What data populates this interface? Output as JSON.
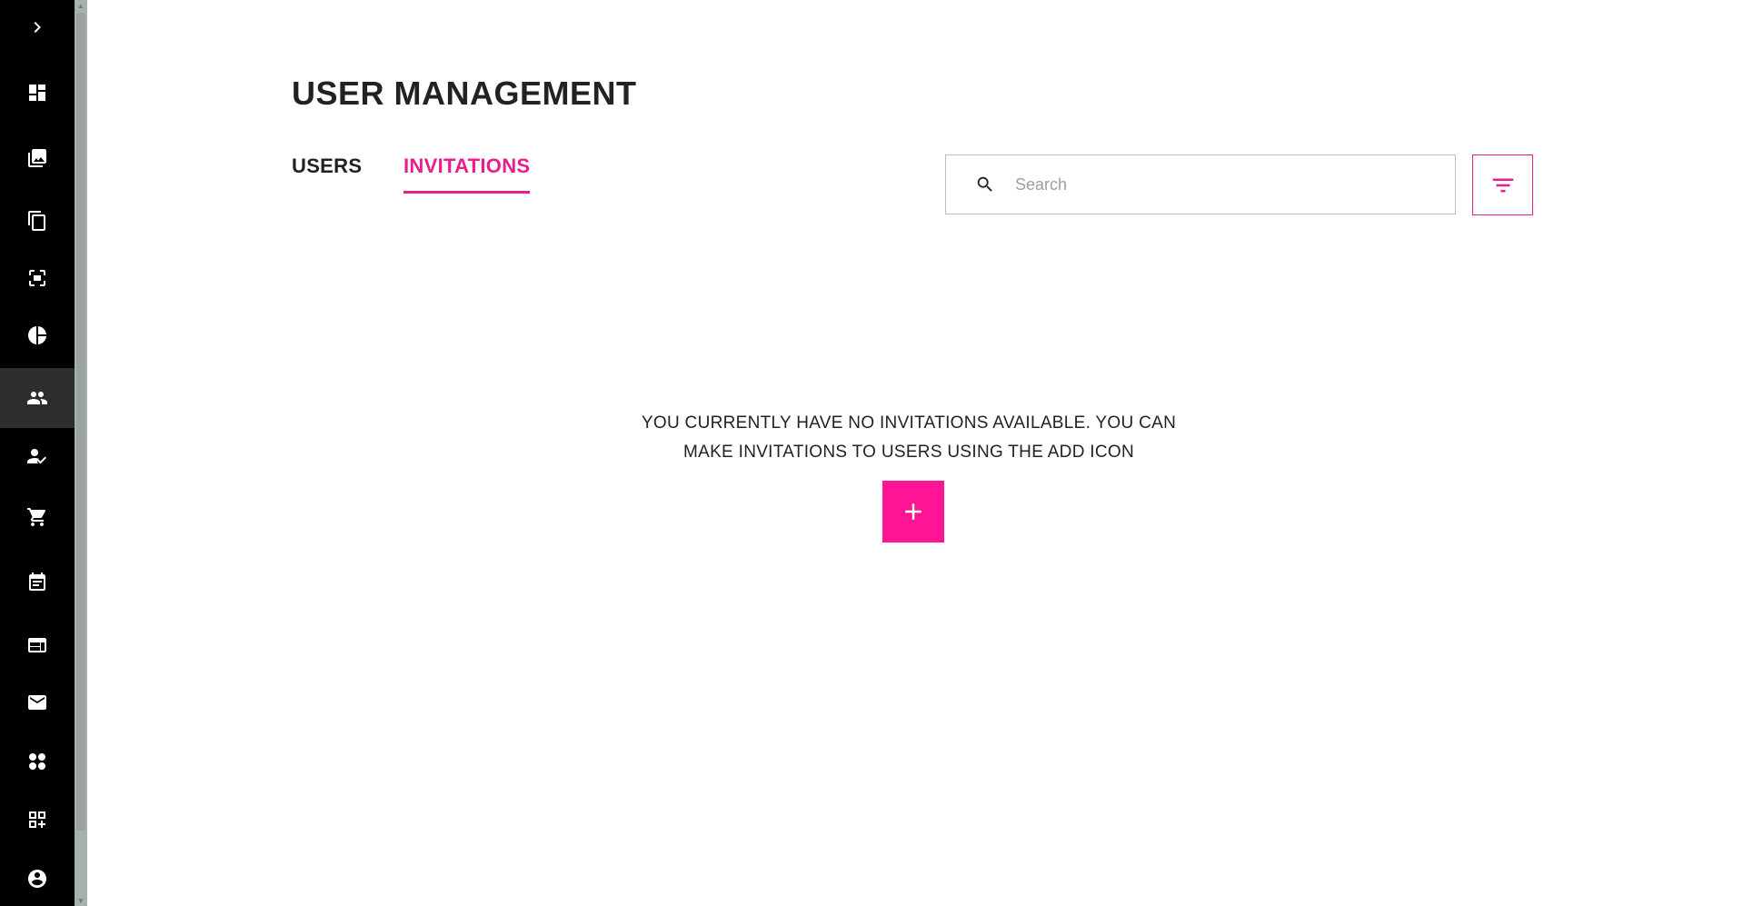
{
  "sidebar": {
    "items": [
      {
        "icon": "chevron-right-icon"
      },
      {
        "icon": "dashboard-icon"
      },
      {
        "icon": "photo-library-icon"
      },
      {
        "icon": "copy-icon"
      },
      {
        "icon": "scan-icon"
      },
      {
        "icon": "pie-chart-icon"
      },
      {
        "icon": "people-icon",
        "active": true
      },
      {
        "icon": "person-check-icon"
      },
      {
        "icon": "shopping-cart-icon"
      },
      {
        "icon": "event-note-icon"
      },
      {
        "icon": "web-icon"
      },
      {
        "icon": "mail-icon"
      },
      {
        "icon": "apps-dots-icon"
      },
      {
        "icon": "add-widget-icon"
      },
      {
        "icon": "account-circle-icon"
      }
    ]
  },
  "header": {
    "title": "USER MANAGEMENT"
  },
  "tabs": [
    {
      "label": "USERS",
      "active": false
    },
    {
      "label": "INVITATIONS",
      "active": true
    }
  ],
  "search": {
    "placeholder": "Search",
    "value": ""
  },
  "empty_state": {
    "line1": "YOU CURRENTLY HAVE NO INVITATIONS AVAILABLE. YOU CAN",
    "line2": "MAKE INVITATIONS TO USERS USING THE ADD ICON"
  },
  "colors": {
    "accent": "#e91e8c",
    "add_button": "#ff1493",
    "sidebar_bg": "#000000",
    "sidebar_active": "#2d2d2d"
  }
}
